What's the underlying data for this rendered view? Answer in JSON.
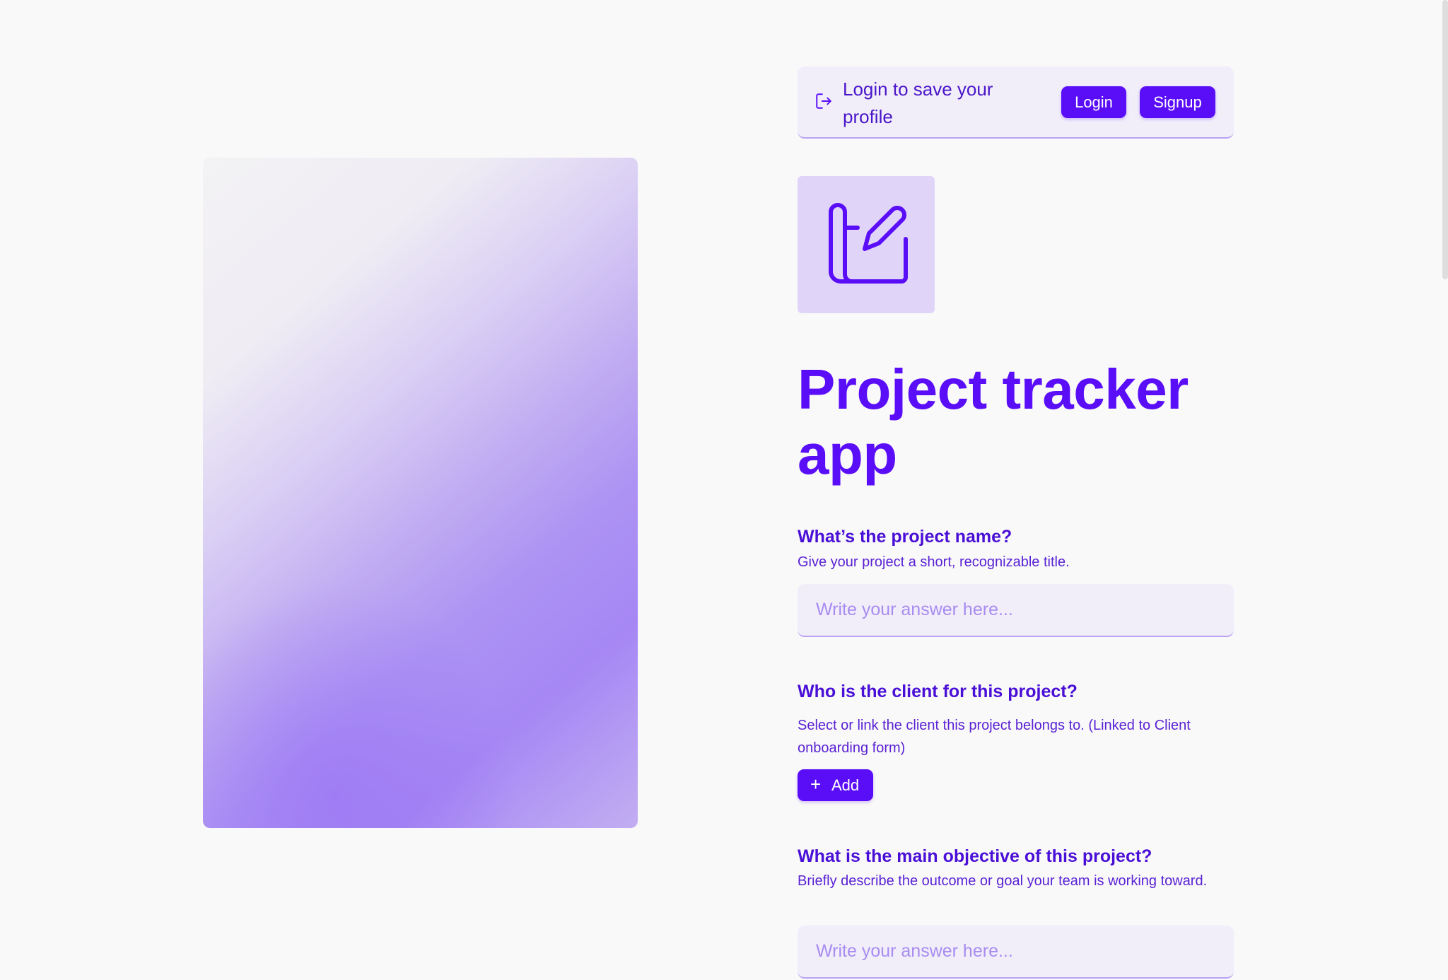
{
  "auth_banner": {
    "message": "Login to save your profile",
    "login_label": "Login",
    "signup_label": "Signup"
  },
  "form": {
    "title": "Project tracker app",
    "icon": "form-edit-icon",
    "questions": [
      {
        "title": "What’s the project name?",
        "description": "Give your project a short, recognizable title.",
        "placeholder": "Write your answer here..."
      },
      {
        "title": "Who is the client for this project?",
        "description": "Select or link the client this project belongs to. (Linked to Client onboarding form)",
        "add_label": "Add"
      },
      {
        "title": "What is the main objective of this project?",
        "description": "Briefly describe the outcome or goal your team is working toward.",
        "placeholder": "Write your answer here..."
      }
    ]
  },
  "colors": {
    "accent": "#5a0df7",
    "text_primary": "#4a0fd6",
    "banner_bg": "#f1eefa",
    "icon_tile_bg": "#e0d5f8",
    "page_bg": "#f9f9f9"
  }
}
